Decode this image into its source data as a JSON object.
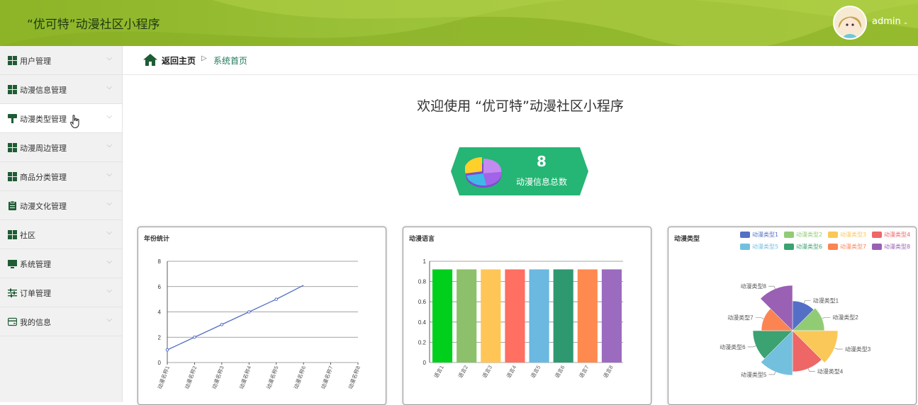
{
  "header": {
    "app_title": "“优可特”动漫社区小程序",
    "username": "admin"
  },
  "sidebar": {
    "items": [
      {
        "label": "用户管理",
        "icon": "grid-icon"
      },
      {
        "label": "动漫信息管理",
        "icon": "grid-icon"
      },
      {
        "label": "动漫类型管理",
        "icon": "paint-roller-icon"
      },
      {
        "label": "动漫周边管理",
        "icon": "grid-icon"
      },
      {
        "label": "商品分类管理",
        "icon": "grid-icon"
      },
      {
        "label": "动漫文化管理",
        "icon": "clipboard-icon"
      },
      {
        "label": "社区",
        "icon": "grid-icon"
      },
      {
        "label": "系统管理",
        "icon": "monitor-icon"
      },
      {
        "label": "订单管理",
        "icon": "sliders-icon"
      },
      {
        "label": "我的信息",
        "icon": "card-icon"
      }
    ],
    "active_index": 2
  },
  "breadcrumb": {
    "home_label": "返回主页",
    "current_label": "系统首页"
  },
  "welcome_text": "欢迎使用 “优可特”动漫社区小程序",
  "stat": {
    "value": "8",
    "label": "动漫信息总数"
  },
  "colors": {
    "header_green": "#9cc23a",
    "stat_green": "#25b574",
    "line_blue": "#5470c6",
    "dark_green": "#1f7a5a"
  },
  "chart_data": [
    {
      "type": "line",
      "title": "年份统计",
      "categories": [
        "动漫名称1",
        "动漫名称2",
        "动漫名称3",
        "动漫名称4",
        "动漫名称5",
        "动漫名称6",
        "动漫名称7",
        "动漫名称8"
      ],
      "values": [
        1,
        2,
        3,
        4,
        5,
        6.1
      ],
      "ylim": [
        0,
        8
      ],
      "yticks": [
        0,
        2,
        4,
        6,
        8
      ],
      "grid": true
    },
    {
      "type": "bar",
      "title": "动漫语言",
      "categories": [
        "语言1",
        "语言2",
        "语言3",
        "语言4",
        "语言5",
        "语言6",
        "语言7",
        "语言8"
      ],
      "values": [
        0.92,
        0.92,
        0.92,
        0.92,
        0.92,
        0.92,
        0.92,
        0.92
      ],
      "colors": [
        "#00d01b",
        "#8cc06a",
        "#ffc657",
        "#ff6f62",
        "#6bb8e0",
        "#2e9870",
        "#ff8a4f",
        "#9b6bbf"
      ],
      "ylim": [
        0,
        1
      ],
      "yticks": [
        0,
        0.2,
        0.4,
        0.6,
        0.8,
        1
      ],
      "grid": true
    },
    {
      "type": "pie",
      "title": "动漫类型",
      "categories": [
        "动漫类型1",
        "动漫类型2",
        "动漫类型3",
        "动漫类型4",
        "动漫类型5",
        "动漫类型6",
        "动漫类型7",
        "动漫类型8"
      ],
      "values": [
        1,
        1,
        1,
        1,
        1,
        1,
        1,
        1
      ],
      "colors": [
        "#5470c6",
        "#91cc75",
        "#fac858",
        "#ee6666",
        "#73c0de",
        "#3ba272",
        "#fc8452",
        "#9a60b4"
      ],
      "legend": "top-right",
      "rose": true
    }
  ]
}
